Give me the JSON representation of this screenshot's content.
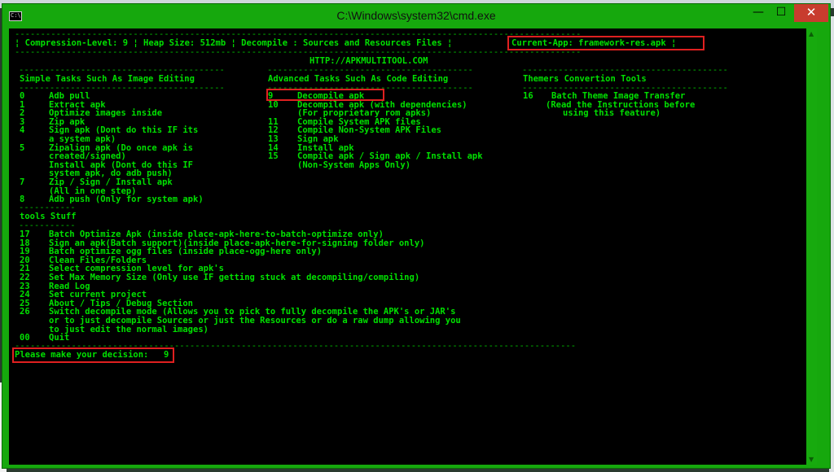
{
  "window": {
    "title": "C:\\Windows\\system32\\cmd.exe",
    "icon_label": "C:\\",
    "min_glyph": "—",
    "max_glyph": "☐",
    "close_glyph": "✕"
  },
  "header": {
    "status": "¦ Compression-Level: 9 ¦ Heap Size: 512mb ¦ Decompile : Sources and Resources Files ¦",
    "current_app": "Current-App: framework-res.apk ¦",
    "rule": "--------------------------------------------------------------------------------------------------------------",
    "url": "HTTP://APKMULTITOOL.COM"
  },
  "sections": {
    "simple_title": "Simple Tasks Such As Image Editing",
    "advanced_title": "Advanced Tasks Such As Code Editing",
    "themers_title": "Themers Convertion Tools",
    "tools_title": "tools Stuff",
    "rule_long": "----------------------------------------",
    "rule_short": "-----------",
    "rule_bottom": "-------------------------------------------------------------------------------------------------------------"
  },
  "simple": [
    {
      "num": "0",
      "text": "Adb pull"
    },
    {
      "num": "1",
      "text": "Extract apk"
    },
    {
      "num": "2",
      "text": "Optimize images inside"
    },
    {
      "num": "3",
      "text": "Zip apk"
    },
    {
      "num": "4",
      "text": "Sign apk (Dont do this IF its"
    },
    {
      "num": "",
      "text": "a system apk)"
    },
    {
      "num": "5",
      "text": "Zipalign apk (Do once apk is"
    },
    {
      "num": "",
      "text": "created/signed)"
    },
    {
      "num": "",
      "text": "Install apk (Dont do this IF"
    },
    {
      "num": "",
      "text": "system apk, do adb push)"
    },
    {
      "num": "7",
      "text": "Zip / Sign / Install apk"
    },
    {
      "num": "",
      "text": "(All in one step)"
    },
    {
      "num": "8",
      "text": "Adb push (Only for system apk)"
    }
  ],
  "advanced": [
    {
      "num": "9",
      "text": "Decompile apk"
    },
    {
      "num": "10",
      "text": "Decompile apk (with dependencies)"
    },
    {
      "num": "",
      "text": "(For proprietary rom apks)"
    },
    {
      "num": "11",
      "text": "Compile System APK files"
    },
    {
      "num": "12",
      "text": "Compile Non-System APK Files"
    },
    {
      "num": "13",
      "text": "Sign apk"
    },
    {
      "num": "14",
      "text": "Install apk"
    },
    {
      "num": "15",
      "text": "Compile apk / Sign apk / Install apk"
    },
    {
      "num": "",
      "text": "(Non-System Apps Only)"
    }
  ],
  "themers": [
    {
      "num": "16",
      "text": "Batch Theme Image Transfer"
    },
    {
      "num": "",
      "text": "(Read the Instructions before"
    },
    {
      "num": "",
      "text": "using this feature)"
    }
  ],
  "tools": [
    {
      "num": "17",
      "text": "Batch Optimize Apk (inside place-apk-here-to-batch-optimize only)"
    },
    {
      "num": "18",
      "text": "Sign an apk(Batch support)(inside place-apk-here-for-signing folder only)"
    },
    {
      "num": "19",
      "text": "Batch optimize ogg files (inside place-ogg-here only)"
    },
    {
      "num": "20",
      "text": "Clean Files/Folders"
    },
    {
      "num": "21",
      "text": "Select compression level for apk's"
    },
    {
      "num": "22",
      "text": "Set Max Memory Size (Only use IF getting stuck at decompiling/compiling)"
    },
    {
      "num": "23",
      "text": "Read Log"
    },
    {
      "num": "24",
      "text": "Set current project"
    },
    {
      "num": "25",
      "text": "About / Tips / Debug Section"
    },
    {
      "num": "26",
      "text": "Switch decompile mode (Allows you to pick to fully decompile the APK's or JAR's"
    },
    {
      "num": "",
      "text": "or to just decompile Sources or just the Resources or do a raw dump allowing you"
    },
    {
      "num": "",
      "text": "to just edit the normal images)"
    },
    {
      "num": "00",
      "text": "Quit"
    }
  ],
  "prompt": {
    "text": "Please make your decision:",
    "value": "9"
  },
  "colors": {
    "console_text": "#00e000",
    "console_bg": "#000000",
    "window_frame": "#16a80d",
    "highlight": "#e02020"
  }
}
